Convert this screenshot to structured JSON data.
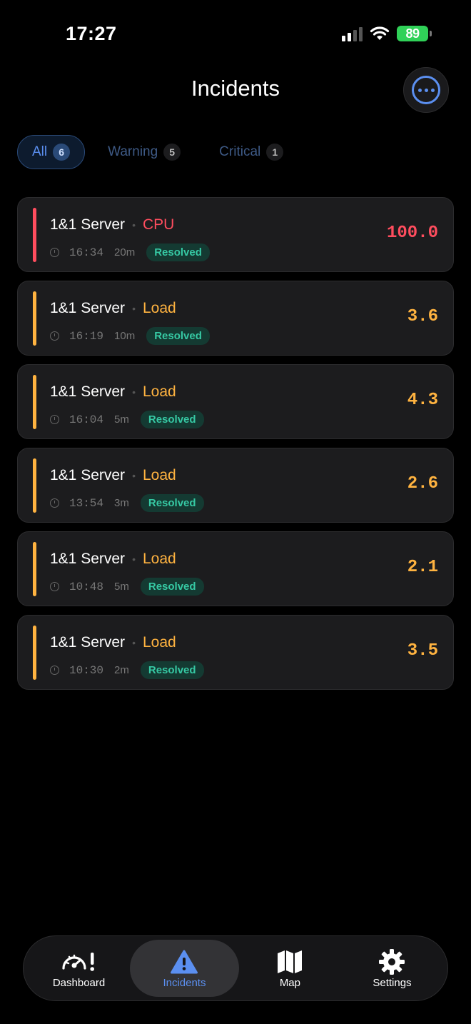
{
  "status_bar": {
    "time": "17:27",
    "battery": "89"
  },
  "header": {
    "title": "Incidents"
  },
  "filters": [
    {
      "label": "All",
      "count": "6"
    },
    {
      "label": "Warning",
      "count": "5"
    },
    {
      "label": "Critical",
      "count": "1"
    }
  ],
  "incidents": [
    {
      "server": "1&1 Server",
      "metric": "CPU",
      "time": "16:34",
      "duration": "20m",
      "status": "Resolved",
      "value": "100.0",
      "severity_color": "#ff4d5e"
    },
    {
      "server": "1&1 Server",
      "metric": "Load",
      "time": "16:19",
      "duration": "10m",
      "status": "Resolved",
      "value": "3.6",
      "severity_color": "#ffb340"
    },
    {
      "server": "1&1 Server",
      "metric": "Load",
      "time": "16:04",
      "duration": "5m",
      "status": "Resolved",
      "value": "4.3",
      "severity_color": "#ffb340"
    },
    {
      "server": "1&1 Server",
      "metric": "Load",
      "time": "13:54",
      "duration": "3m",
      "status": "Resolved",
      "value": "2.6",
      "severity_color": "#ffb340"
    },
    {
      "server": "1&1 Server",
      "metric": "Load",
      "time": "10:48",
      "duration": "5m",
      "status": "Resolved",
      "value": "2.1",
      "severity_color": "#ffb340"
    },
    {
      "server": "1&1 Server",
      "metric": "Load",
      "time": "10:30",
      "duration": "2m",
      "status": "Resolved",
      "value": "3.5",
      "severity_color": "#ffb340"
    }
  ],
  "tabbar": [
    {
      "label": "Dashboard",
      "icon": "speedometer-alert-icon"
    },
    {
      "label": "Incidents",
      "icon": "warning-triangle-icon"
    },
    {
      "label": "Map",
      "icon": "map-icon"
    },
    {
      "label": "Settings",
      "icon": "gear-icon"
    }
  ],
  "colors": {
    "accent": "#5b8ff0",
    "critical": "#ff4d5e",
    "warning": "#ffb340",
    "resolved": "#36c9a4"
  }
}
